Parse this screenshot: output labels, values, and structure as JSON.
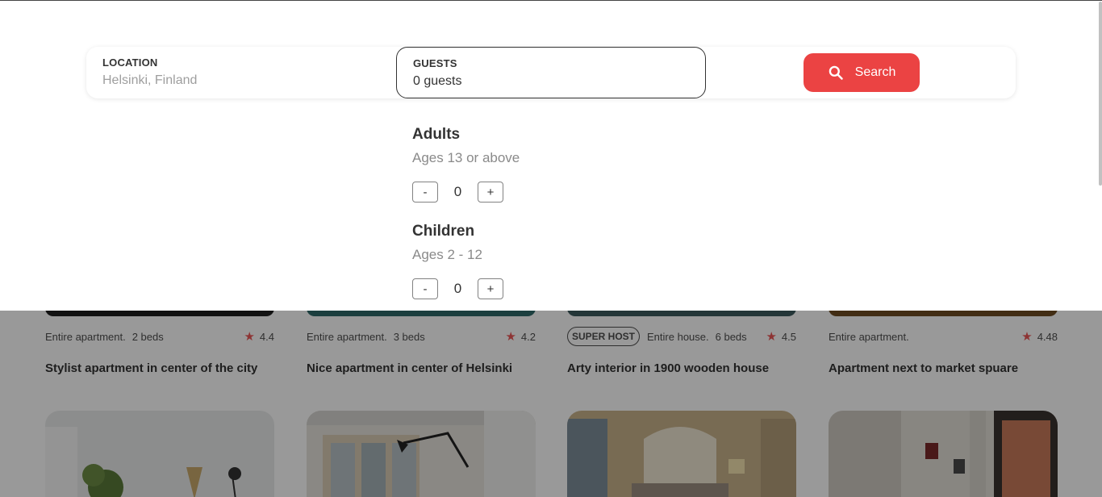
{
  "search": {
    "location_label": "LOCATION",
    "location_placeholder": "Helsinki, Finland",
    "guests_label": "GUESTS",
    "guests_value": "0 guests",
    "search_button_label": "Search",
    "search_icon": "search-icon"
  },
  "guests": {
    "adults": {
      "title": "Adults",
      "subtitle": "Ages 13 or above",
      "minus": "-",
      "count": "0",
      "plus": "+"
    },
    "children": {
      "title": "Children",
      "subtitle": "Ages 2 - 12",
      "minus": "-",
      "count": "0",
      "plus": "+"
    }
  },
  "listings": [
    {
      "superhost": "",
      "type": "Entire apartment.",
      "beds": "2 beds",
      "rating": "4.4",
      "title": "Stylist apartment in center of the city"
    },
    {
      "superhost": "",
      "type": "Entire apartment.",
      "beds": "3 beds",
      "rating": "4.2",
      "title": "Nice apartment in center of Helsinki"
    },
    {
      "superhost": "SUPER HOST",
      "type": "Entire house.",
      "beds": "6 beds",
      "rating": "4.5",
      "title": "Arty interior in 1900 wooden house"
    },
    {
      "superhost": "",
      "type": "Entire apartment.",
      "beds": "",
      "rating": "4.48",
      "title": "Apartment next to market spuare"
    }
  ],
  "colors": {
    "accent": "#eb4343",
    "star": "#eb5757",
    "overlay": "rgba(0,0,0,0.40)"
  }
}
